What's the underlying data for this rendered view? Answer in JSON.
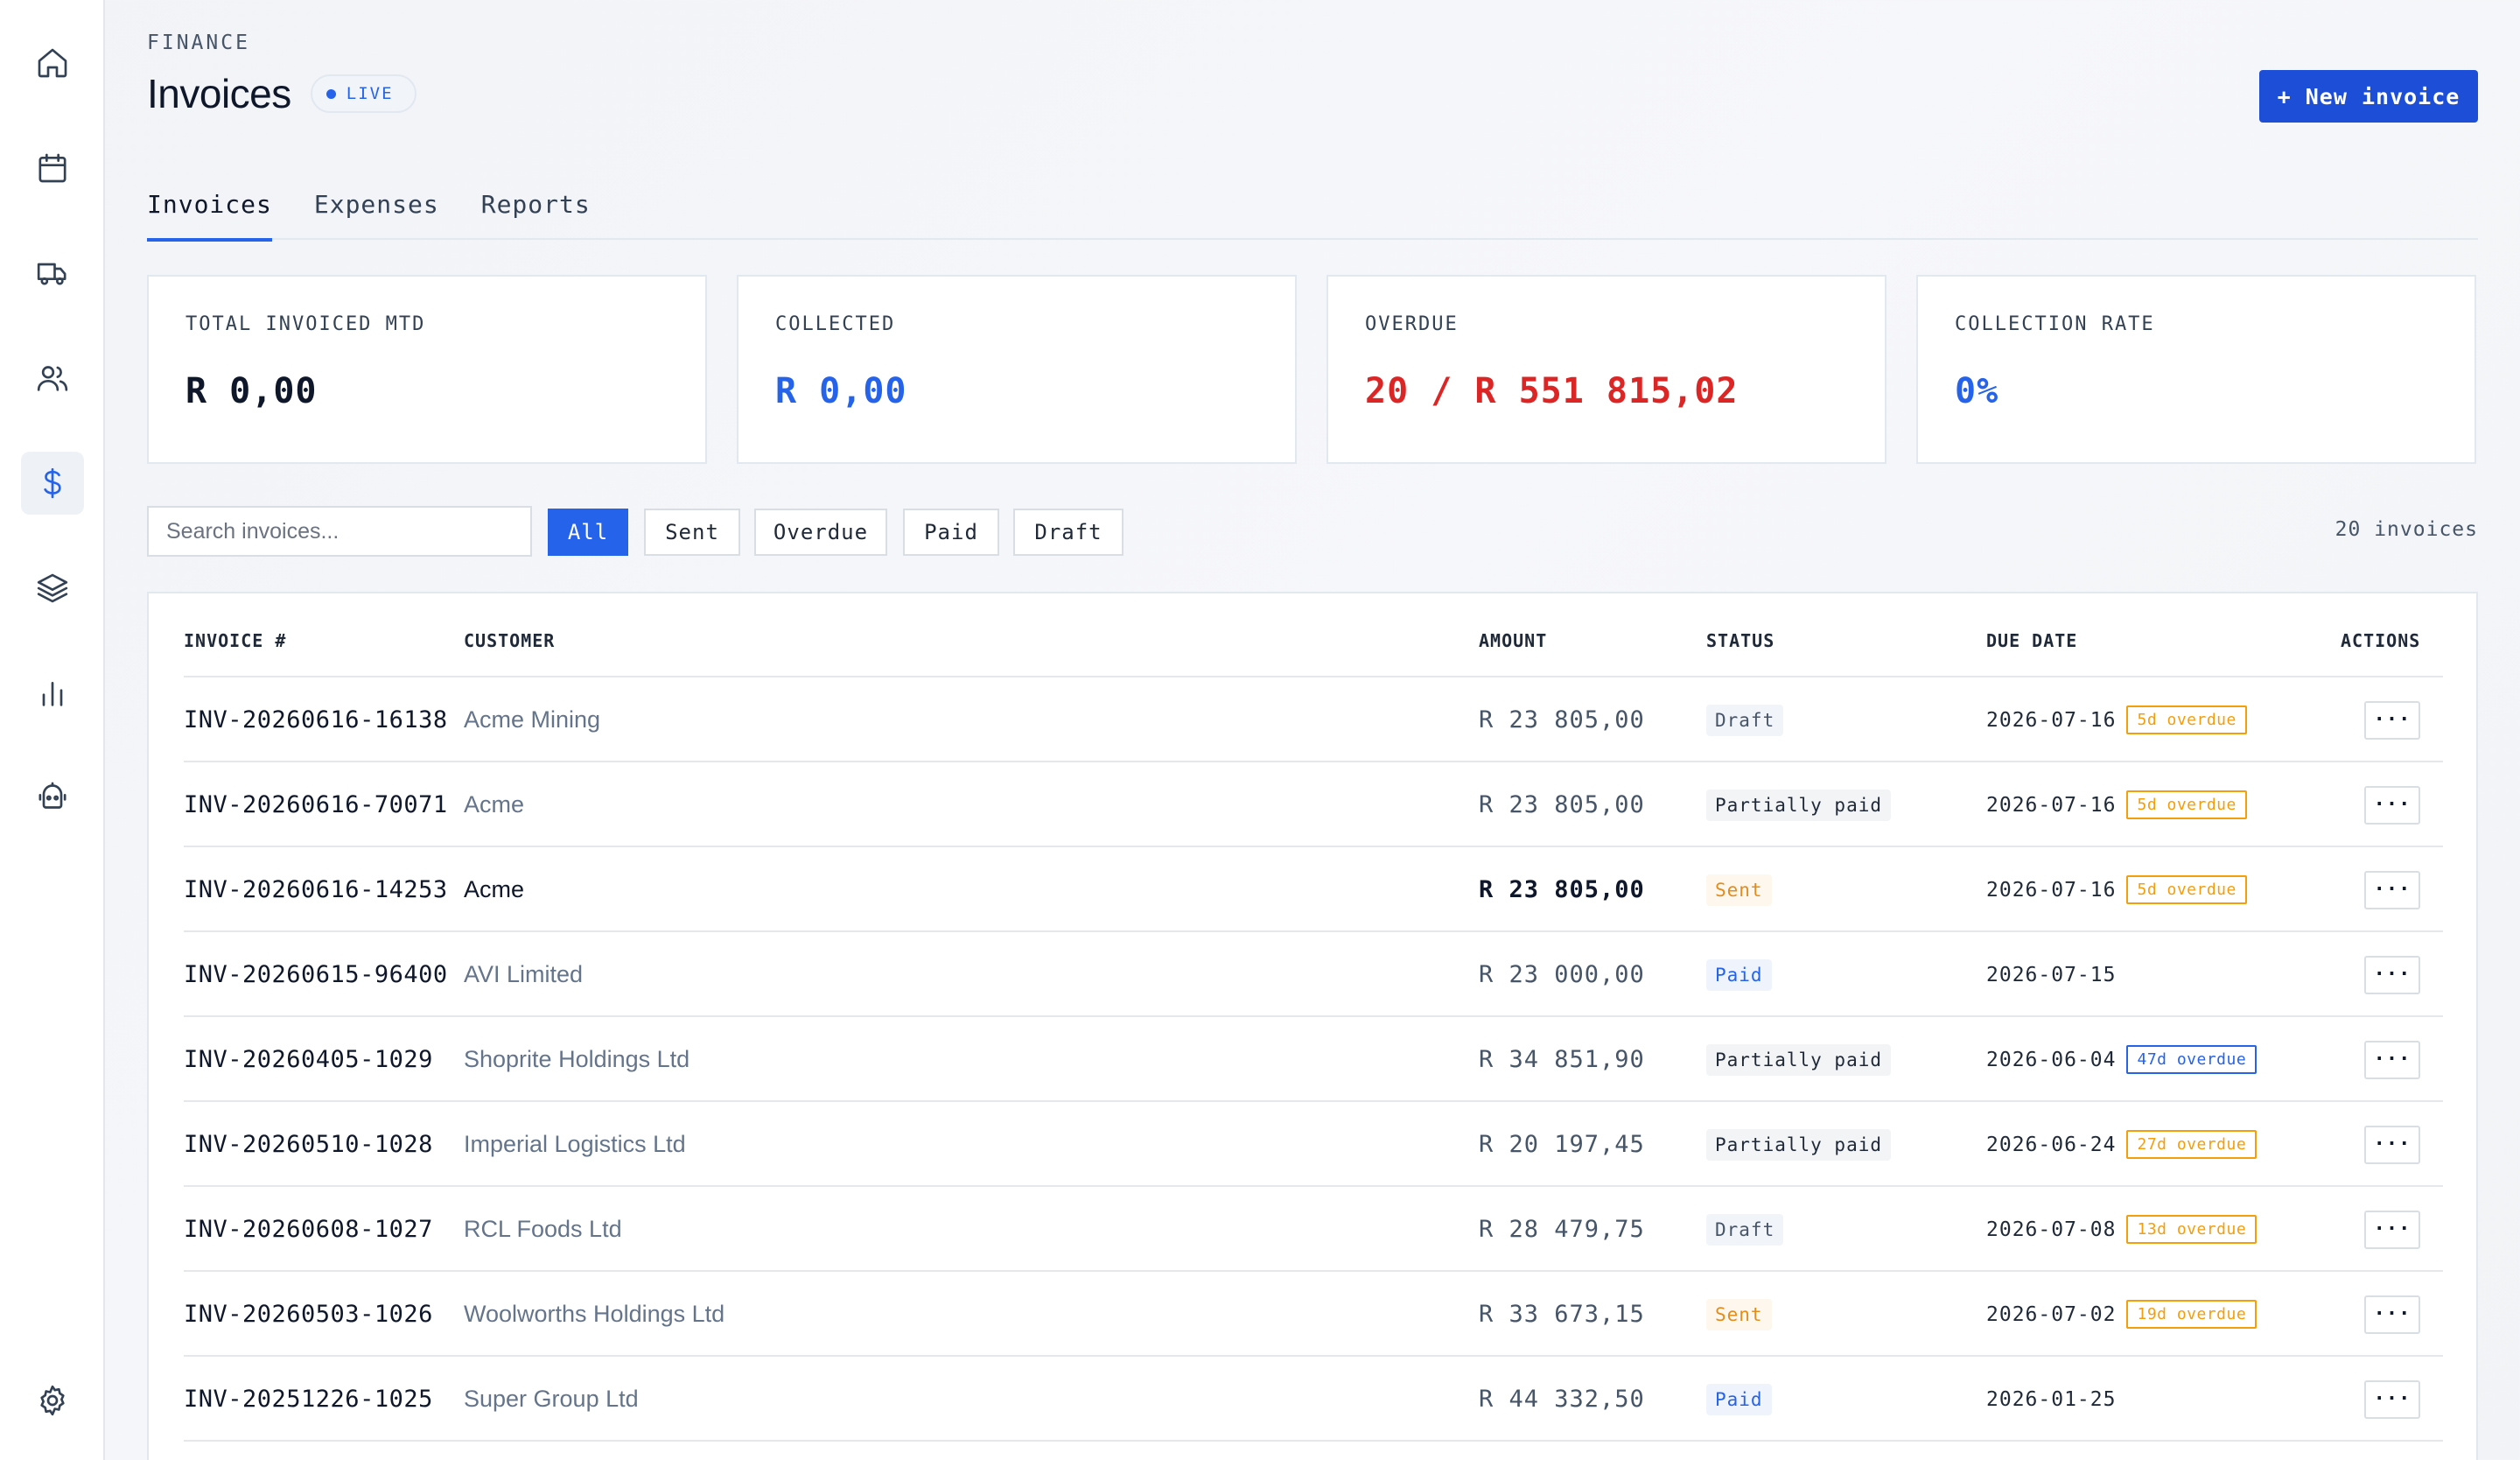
{
  "sidebar": {
    "items": [
      {
        "name": "home-icon",
        "active": false
      },
      {
        "name": "calendar-icon",
        "active": false
      },
      {
        "name": "truck-icon",
        "active": false
      },
      {
        "name": "users-icon",
        "active": false
      },
      {
        "name": "dollar-icon",
        "active": true
      },
      {
        "name": "layers-icon",
        "active": false
      },
      {
        "name": "bar-chart-icon",
        "active": false
      },
      {
        "name": "bot-icon",
        "active": false
      }
    ],
    "settings_icon": "gear-icon"
  },
  "header": {
    "eyebrow": "FINANCE",
    "title": "Invoices",
    "badge": "LIVE",
    "new_button": "+ New invoice"
  },
  "tabs": [
    {
      "label": "Invoices",
      "active": true
    },
    {
      "label": "Expenses",
      "active": false
    },
    {
      "label": "Reports",
      "active": false
    }
  ],
  "kpis": [
    {
      "label": "TOTAL INVOICED MTD",
      "value": "R 0,00",
      "color": "#0f172a"
    },
    {
      "label": "COLLECTED",
      "value": "R 0,00",
      "color": "#2563eb"
    },
    {
      "label": "OVERDUE",
      "value": "20 / R 551 815,02",
      "color": "#dc2626"
    },
    {
      "label": "COLLECTION RATE",
      "value": "0%",
      "color": "#2563eb"
    }
  ],
  "filters": {
    "search_placeholder": "Search invoices...",
    "chips": [
      "All",
      "Sent",
      "Overdue",
      "Paid",
      "Draft"
    ],
    "active_chip": "All",
    "count": "20 invoices"
  },
  "table": {
    "columns": {
      "invoice": "INVOICE #",
      "customer": "CUSTOMER",
      "amount": "AMOUNT",
      "status": "STATUS",
      "due": "DUE DATE",
      "actions": "ACTIONS"
    },
    "actions_label": "···",
    "rows": [
      {
        "invoice": "INV-20260616-16138",
        "customer": "Acme Mining",
        "amount": "R 23 805,00",
        "status": "Draft",
        "status_kind": "draft",
        "due": "2026-07-16",
        "overdue": "5d overdue",
        "overdue_kind": "orange",
        "emphasis": false
      },
      {
        "invoice": "INV-20260616-70071",
        "customer": "Acme",
        "amount": "R 23 805,00",
        "status": "Partially paid",
        "status_kind": "partial",
        "due": "2026-07-16",
        "overdue": "5d overdue",
        "overdue_kind": "orange",
        "emphasis": false
      },
      {
        "invoice": "INV-20260616-14253",
        "customer": "Acme",
        "amount": "R 23 805,00",
        "status": "Sent",
        "status_kind": "sent",
        "due": "2026-07-16",
        "overdue": "5d overdue",
        "overdue_kind": "orange",
        "emphasis": true
      },
      {
        "invoice": "INV-20260615-96400",
        "customer": "AVI Limited",
        "amount": "R 23 000,00",
        "status": "Paid",
        "status_kind": "paid",
        "due": "2026-07-15",
        "overdue": "",
        "overdue_kind": "",
        "emphasis": false
      },
      {
        "invoice": "INV-20260405-1029",
        "customer": "Shoprite Holdings Ltd",
        "amount": "R 34 851,90",
        "status": "Partially paid",
        "status_kind": "partial",
        "due": "2026-06-04",
        "overdue": "47d overdue",
        "overdue_kind": "blue",
        "emphasis": false
      },
      {
        "invoice": "INV-20260510-1028",
        "customer": "Imperial Logistics Ltd",
        "amount": "R 20 197,45",
        "status": "Partially paid",
        "status_kind": "partial",
        "due": "2026-06-24",
        "overdue": "27d overdue",
        "overdue_kind": "orange",
        "emphasis": false
      },
      {
        "invoice": "INV-20260608-1027",
        "customer": "RCL Foods Ltd",
        "amount": "R 28 479,75",
        "status": "Draft",
        "status_kind": "draft",
        "due": "2026-07-08",
        "overdue": "13d overdue",
        "overdue_kind": "orange",
        "emphasis": false
      },
      {
        "invoice": "INV-20260503-1026",
        "customer": "Woolworths Holdings Ltd",
        "amount": "R 33 673,15",
        "status": "Sent",
        "status_kind": "sent",
        "due": "2026-07-02",
        "overdue": "19d overdue",
        "overdue_kind": "orange",
        "emphasis": false
      },
      {
        "invoice": "INV-20251226-1025",
        "customer": "Super Group Ltd",
        "amount": "R 44 332,50",
        "status": "Paid",
        "status_kind": "paid",
        "due": "2026-01-25",
        "overdue": "",
        "overdue_kind": "",
        "emphasis": false
      }
    ]
  }
}
